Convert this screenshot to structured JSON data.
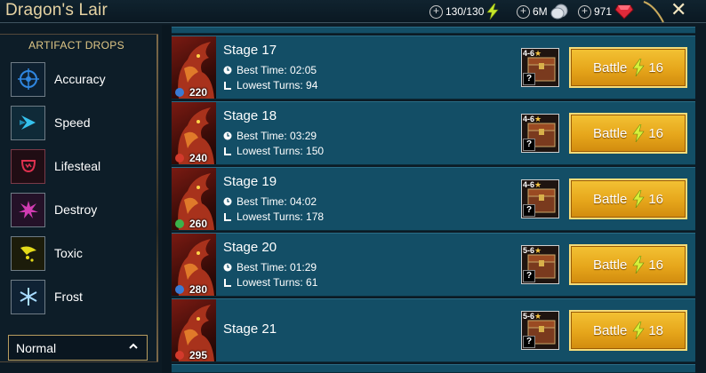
{
  "header": {
    "title": "Dragon's Lair",
    "energy": "130/130",
    "silver": "6M",
    "gems": "971",
    "close_symbol": "✕"
  },
  "sidebar": {
    "title": "ARTIFACT DROPS",
    "items": [
      {
        "label": "Accuracy",
        "icon": "accuracy-icon",
        "color": "#1d6fc4"
      },
      {
        "label": "Speed",
        "icon": "speed-icon",
        "color": "#29b6e3"
      },
      {
        "label": "Lifesteal",
        "icon": "lifesteal-icon",
        "color": "#c4264c"
      },
      {
        "label": "Destroy",
        "icon": "destroy-icon",
        "color": "#c23aa6"
      },
      {
        "label": "Toxic",
        "icon": "toxic-icon",
        "color": "#d9cf17"
      },
      {
        "label": "Frost",
        "icon": "frost-icon",
        "color": "#7fc7ff"
      }
    ],
    "difficulty": "Normal"
  },
  "stages": [
    {
      "name": "Stage 17",
      "best_time": "Best Time: 02:05",
      "lowest_turns": "Lowest Turns: 94",
      "power": "220",
      "tier": "4-6",
      "battle_label": "Battle",
      "energy_cost": "16",
      "affinity_color": "#3a7bd5"
    },
    {
      "name": "Stage 18",
      "best_time": "Best Time: 03:29",
      "lowest_turns": "Lowest Turns: 150",
      "power": "240",
      "tier": "4-6",
      "battle_label": "Battle",
      "energy_cost": "16",
      "affinity_color": "#d33a2c"
    },
    {
      "name": "Stage 19",
      "best_time": "Best Time: 04:02",
      "lowest_turns": "Lowest Turns: 178",
      "power": "260",
      "tier": "4-6",
      "battle_label": "Battle",
      "energy_cost": "16",
      "affinity_color": "#3bb24a"
    },
    {
      "name": "Stage 20",
      "best_time": "Best Time: 01:29",
      "lowest_turns": "Lowest Turns: 61",
      "power": "280",
      "tier": "5-6",
      "battle_label": "Battle",
      "energy_cost": "16",
      "affinity_color": "#3a7bd5"
    },
    {
      "name": "Stage 21",
      "power": "295",
      "tier": "5-6",
      "battle_label": "Battle",
      "energy_cost": "18",
      "affinity_color": "#d33a2c"
    }
  ]
}
